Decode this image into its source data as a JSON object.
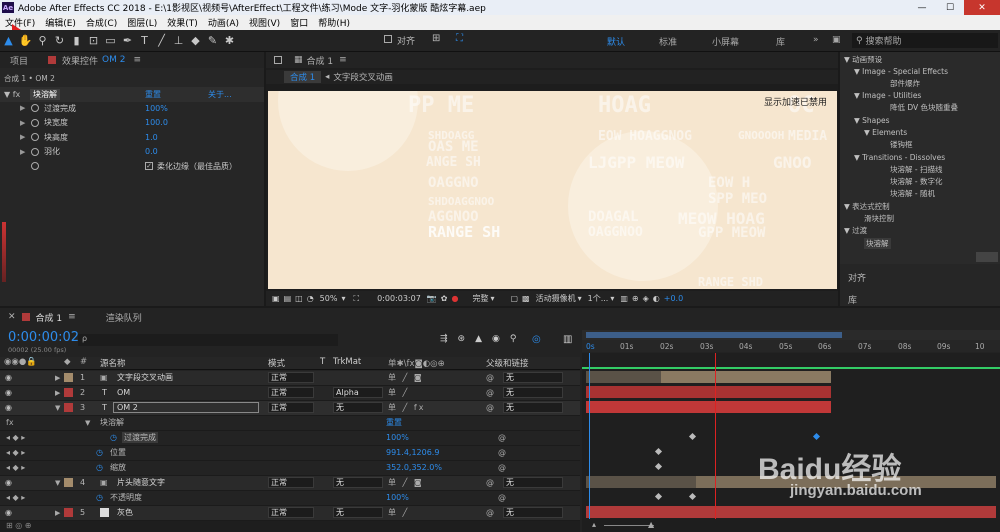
{
  "window": {
    "title": "Adobe After Effects CC 2018 - E:\\1影视区\\视频号\\AfterEffect\\工程文件\\练习\\Mode 文字-羽化蒙版 酷炫字幕.aep",
    "app_icon": "Ae"
  },
  "menu": [
    "文件(F)",
    "编辑(E)",
    "合成(C)",
    "图层(L)",
    "效果(T)",
    "动画(A)",
    "视图(V)",
    "窗口",
    "帮助(H)"
  ],
  "toolbar": {
    "align_label": "对齐",
    "workspaces": [
      "默认",
      "标准",
      "小屏幕",
      "库"
    ],
    "search_placeholder": "搜索帮助"
  },
  "left_panel": {
    "tab_project": "项目",
    "tab_effect": "效果控件",
    "effect_layer": "OM 2",
    "breadcrumb": "合成 1 • OM 2",
    "effect_name": "块溶解",
    "reset": "重置",
    "about": "关于...",
    "props": [
      {
        "label": "过渡完成",
        "value": "100%"
      },
      {
        "label": "块宽度",
        "value": "100.0"
      },
      {
        "label": "块高度",
        "value": "1.0"
      },
      {
        "label": "羽化",
        "value": "0.0"
      }
    ],
    "soft_edge_label": "柔化边缘（最佳品质）"
  },
  "viewer": {
    "tab": "合成 1",
    "layer_label": "文字段交叉动画",
    "gpu_notice": "显示加速已禁用",
    "zoom": "50%",
    "timecode": "0:00:03:07",
    "quality": "完整",
    "camera": "活动摄像机",
    "views": "1个...",
    "exposure": "+0.0",
    "text_lines": [
      "PP ME",
      "HOAG",
      "OC",
      "SHDOAGG",
      "GNOOOOH",
      "OAS ME",
      "EOW HOAGGNOG",
      "MEDIA",
      "ANGE SH",
      "LJGPP MEOW",
      "GNOO",
      "OAGGNO",
      "EOW H",
      "SHDOAGGNOO",
      "SPP MEO",
      "AGGNOO",
      "DOAGAL",
      "MEOW HOAG",
      "RANGE SH",
      "OAGGNOO",
      "GPP MEOW",
      "RANGE SHD"
    ]
  },
  "right_panel": {
    "tree": [
      "▼ 动画预设",
      "▼ Image - Special Effects",
      "部件爆炸",
      "▼ Image - Utilities",
      "降低 DV 色块随重叠",
      "▼ Shapes",
      "▼ Elements",
      "镂钩框",
      "▼ Transitions - Dissolves",
      "块溶解 - 扫描线",
      "块溶解 - 数字化",
      "块溶解 - 随机",
      "▼ 表达式控制",
      "滑块控制",
      "▼ 过渡",
      "块溶解"
    ],
    "align": "对齐",
    "library": "库"
  },
  "timeline": {
    "tab_comp": "合成 1",
    "tab_render": "渲染队列",
    "timecode": "0:00:00:02",
    "fps": "00002 (25.00 fps)",
    "search_placeholder": "ρ",
    "headers": {
      "name": "源名称",
      "mode": "模式",
      "t": "T",
      "trkmat": "TrkMat",
      "parent": "父级和链接"
    },
    "ruler": [
      "0s",
      "01s",
      "02s",
      "03s",
      "04s",
      "05s",
      "06s",
      "07s",
      "08s",
      "09s",
      "10"
    ],
    "layers": [
      {
        "num": "1",
        "name": "文字段交叉动画",
        "mode": "正常",
        "trkmat": "",
        "parent": "无",
        "color": "#a48c6c"
      },
      {
        "num": "2",
        "name": "OM",
        "mode": "正常",
        "trkmat": "Alpha",
        "parent": "无",
        "color": "#b03a3a"
      },
      {
        "num": "3",
        "name": "OM 2",
        "mode": "正常",
        "trkmat": "无",
        "parent": "无",
        "color": "#b03a3a"
      },
      {
        "num": "4",
        "name": "片头随意文字",
        "mode": "正常",
        "trkmat": "无",
        "parent": "无",
        "color": "#a48c6c"
      },
      {
        "num": "5",
        "name": "灰色",
        "mode": "正常",
        "trkmat": "无",
        "parent": "无",
        "color": "#b03a3a"
      }
    ],
    "sub": {
      "effects": "效果",
      "block": "块溶解",
      "reset": "重置",
      "trans": "过渡完成",
      "trans_val": "100%",
      "pos": "位置",
      "pos_val": "991.4,1206.9",
      "scale": "缩放",
      "scale_val": "352.0,352.0%",
      "opacity": "不透明度",
      "opacity_val": "100%"
    }
  },
  "watermark": {
    "logo": "Baidu经验",
    "url": "jingyan.baidu.com"
  }
}
